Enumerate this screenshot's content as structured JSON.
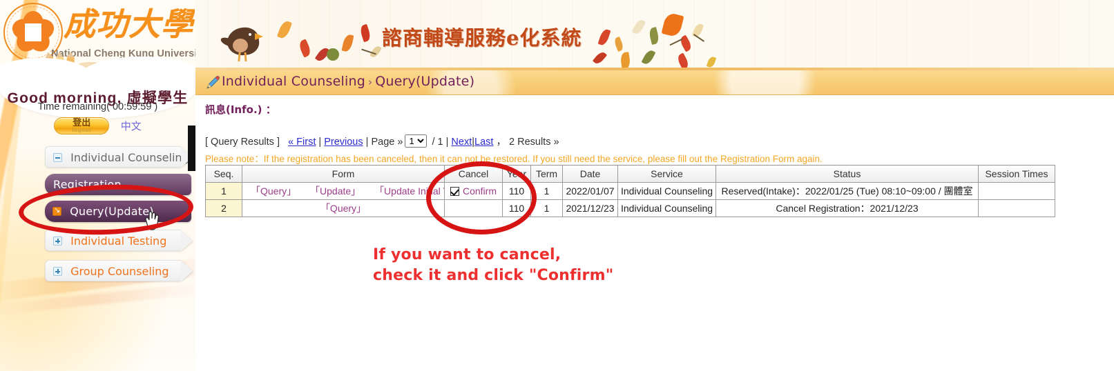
{
  "sidebar": {
    "university_cn": "成功大學",
    "university_en": "National Cheng Kung University",
    "greeting": "Good morning, 虛擬學生",
    "time_remaining": "Time remaining( 00:59:59 )",
    "logout_cn": "登出",
    "logout_en": "logout",
    "lang_link": "中文",
    "menu": [
      {
        "label": "Individual Counseling",
        "icon": "minus-box-icon",
        "type": "top",
        "state": "expanded"
      },
      {
        "label": "Registration",
        "icon": "none",
        "type": "sub",
        "state": "normal"
      },
      {
        "label": "Query(Update)",
        "icon": "arrow-box-icon",
        "type": "sub",
        "state": "active"
      },
      {
        "label": "Individual Testing",
        "icon": "plus-box-icon",
        "type": "top",
        "state": "collapsed"
      },
      {
        "label": "Group Counseling",
        "icon": "plus-box-icon",
        "type": "top",
        "state": "collapsed"
      }
    ]
  },
  "banner": {
    "title": "諮商輔導服務e化系統"
  },
  "breadcrumb": {
    "parent": "Individual Counseling",
    "separator": "›",
    "current": "Query(Update)"
  },
  "info": {
    "label": "訊息(Info.) ："
  },
  "pager": {
    "results_label": "[ Query Results ]",
    "first": "« First",
    "sep1": "|",
    "previous": "Previous",
    "sep2": "|",
    "page_label": "Page »",
    "page_value": "1",
    "page_options": [
      "1"
    ],
    "of": "/ 1 |",
    "next": "Next",
    "sep3": "|",
    "last": "Last",
    "results_count": "， 2 Results »"
  },
  "note": "Please note：If the registration has been canceled, then it can not be restored. If you still need the service, please fill out the Registration Form again.",
  "table": {
    "headers": [
      "Seq.",
      "Form",
      "Cancel",
      "Year",
      "Term",
      "Date",
      "Service",
      "Status",
      "Session Times"
    ],
    "rows": [
      {
        "seq": "1",
        "form_links": [
          "「Query」",
          "「Update」",
          "「Update Initial Time」"
        ],
        "cancel_label": "Confirm",
        "cancel_checked": true,
        "year": "110",
        "term": "1",
        "date": "2022/01/07",
        "service": "Individual Counseling",
        "status": "Reserved(Intake)：2022/01/25 (Tue) 08:10~09:00 / 團體室",
        "session_times": ""
      },
      {
        "seq": "2",
        "form_links": [
          "「Query」"
        ],
        "cancel_label": "",
        "cancel_checked": false,
        "year": "110",
        "term": "1",
        "date": "2021/12/23",
        "service": "Individual Counseling",
        "status": "Cancel Registration：2021/12/23",
        "session_times": ""
      }
    ]
  },
  "annotation": {
    "line1": "If you want to cancel,",
    "line2": "check it and click \"Confirm\""
  },
  "colors": {
    "annotation_red": "#ee2f2f",
    "ellipse_red": "#d61414",
    "note_orange": "#f5a623",
    "breadcrumb_purple": "#72205a",
    "menu_orange": "#f0721c",
    "link_blue": "#2a2ad0",
    "form_link_purple": "#9b3d88"
  }
}
